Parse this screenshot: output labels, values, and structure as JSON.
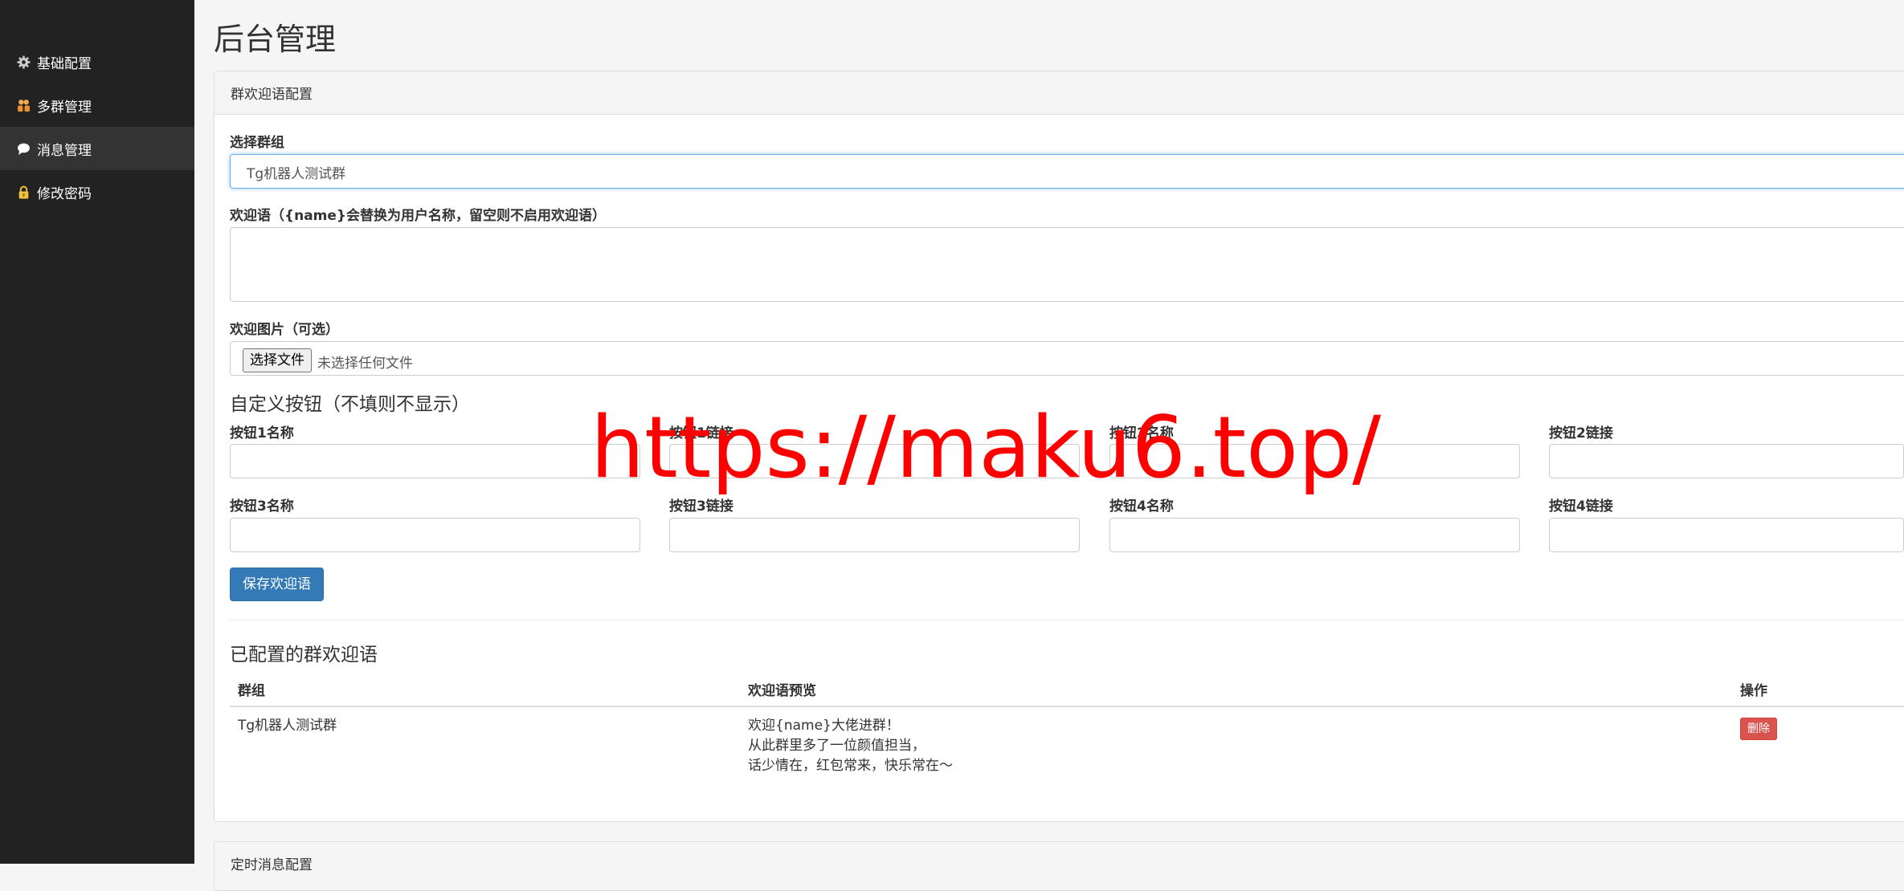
{
  "sidebar": {
    "items": [
      {
        "label": "基础配置",
        "icon": "gear-icon"
      },
      {
        "label": "多群管理",
        "icon": "users-icon"
      },
      {
        "label": "消息管理",
        "icon": "chat-bubble-icon"
      },
      {
        "label": "修改密码",
        "icon": "lock-icon"
      }
    ],
    "active_index": 2
  },
  "page": {
    "title": "后台管理"
  },
  "welcome_panel": {
    "heading": "群欢迎语配置",
    "group_label": "选择群组",
    "group_value": "Tg机器人测试群",
    "message_label": "欢迎语（{name}会替换为用户名称，留空则不启用欢迎语）",
    "message_value": "",
    "image_label": "欢迎图片（可选）",
    "file_button": "选择文件",
    "file_status": "未选择任何文件",
    "custom_buttons_heading": "自定义按钮（不填则不显示）",
    "button_fields": [
      {
        "label": "按钮1名称",
        "value": ""
      },
      {
        "label": "按钮1链接",
        "value": ""
      },
      {
        "label": "按钮2名称",
        "value": ""
      },
      {
        "label": "按钮2链接",
        "value": ""
      },
      {
        "label": "按钮3名称",
        "value": ""
      },
      {
        "label": "按钮3链接",
        "value": ""
      },
      {
        "label": "按钮4名称",
        "value": ""
      },
      {
        "label": "按钮4链接",
        "value": ""
      }
    ],
    "save_button": "保存欢迎语",
    "configured_heading": "已配置的群欢迎语",
    "table": {
      "columns": [
        "群组",
        "欢迎语预览",
        "操作"
      ],
      "rows": [
        {
          "group": "Tg机器人测试群",
          "preview": [
            "欢迎{name}大佬进群！",
            "从此群里多了一位颜值担当，",
            "话少情在，红包常来，快乐常在～"
          ],
          "action": "删除"
        }
      ]
    }
  },
  "scheduled_panel": {
    "heading": "定时消息配置"
  },
  "watermark": {
    "text": "https://maku6.top/",
    "color": "#ff0000"
  },
  "colors": {
    "sidebar_bg": "#222222",
    "active_bg": "#333333",
    "primary": "#337ab7",
    "danger": "#d9534f"
  }
}
